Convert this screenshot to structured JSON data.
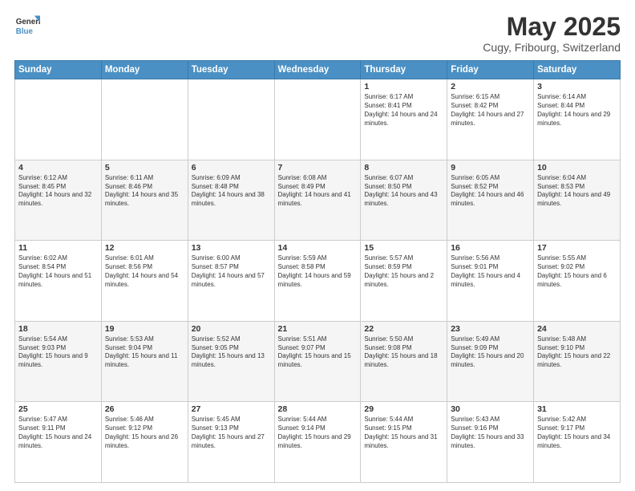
{
  "logo": {
    "line1": "General",
    "line2": "Blue"
  },
  "title": "May 2025",
  "subtitle": "Cugy, Fribourg, Switzerland",
  "days_header": [
    "Sunday",
    "Monday",
    "Tuesday",
    "Wednesday",
    "Thursday",
    "Friday",
    "Saturday"
  ],
  "weeks": [
    [
      {
        "day": "",
        "info": ""
      },
      {
        "day": "",
        "info": ""
      },
      {
        "day": "",
        "info": ""
      },
      {
        "day": "",
        "info": ""
      },
      {
        "day": "1",
        "info": "Sunrise: 6:17 AM\nSunset: 8:41 PM\nDaylight: 14 hours and 24 minutes."
      },
      {
        "day": "2",
        "info": "Sunrise: 6:15 AM\nSunset: 8:42 PM\nDaylight: 14 hours and 27 minutes."
      },
      {
        "day": "3",
        "info": "Sunrise: 6:14 AM\nSunset: 8:44 PM\nDaylight: 14 hours and 29 minutes."
      }
    ],
    [
      {
        "day": "4",
        "info": "Sunrise: 6:12 AM\nSunset: 8:45 PM\nDaylight: 14 hours and 32 minutes."
      },
      {
        "day": "5",
        "info": "Sunrise: 6:11 AM\nSunset: 8:46 PM\nDaylight: 14 hours and 35 minutes."
      },
      {
        "day": "6",
        "info": "Sunrise: 6:09 AM\nSunset: 8:48 PM\nDaylight: 14 hours and 38 minutes."
      },
      {
        "day": "7",
        "info": "Sunrise: 6:08 AM\nSunset: 8:49 PM\nDaylight: 14 hours and 41 minutes."
      },
      {
        "day": "8",
        "info": "Sunrise: 6:07 AM\nSunset: 8:50 PM\nDaylight: 14 hours and 43 minutes."
      },
      {
        "day": "9",
        "info": "Sunrise: 6:05 AM\nSunset: 8:52 PM\nDaylight: 14 hours and 46 minutes."
      },
      {
        "day": "10",
        "info": "Sunrise: 6:04 AM\nSunset: 8:53 PM\nDaylight: 14 hours and 49 minutes."
      }
    ],
    [
      {
        "day": "11",
        "info": "Sunrise: 6:02 AM\nSunset: 8:54 PM\nDaylight: 14 hours and 51 minutes."
      },
      {
        "day": "12",
        "info": "Sunrise: 6:01 AM\nSunset: 8:56 PM\nDaylight: 14 hours and 54 minutes."
      },
      {
        "day": "13",
        "info": "Sunrise: 6:00 AM\nSunset: 8:57 PM\nDaylight: 14 hours and 57 minutes."
      },
      {
        "day": "14",
        "info": "Sunrise: 5:59 AM\nSunset: 8:58 PM\nDaylight: 14 hours and 59 minutes."
      },
      {
        "day": "15",
        "info": "Sunrise: 5:57 AM\nSunset: 8:59 PM\nDaylight: 15 hours and 2 minutes."
      },
      {
        "day": "16",
        "info": "Sunrise: 5:56 AM\nSunset: 9:01 PM\nDaylight: 15 hours and 4 minutes."
      },
      {
        "day": "17",
        "info": "Sunrise: 5:55 AM\nSunset: 9:02 PM\nDaylight: 15 hours and 6 minutes."
      }
    ],
    [
      {
        "day": "18",
        "info": "Sunrise: 5:54 AM\nSunset: 9:03 PM\nDaylight: 15 hours and 9 minutes."
      },
      {
        "day": "19",
        "info": "Sunrise: 5:53 AM\nSunset: 9:04 PM\nDaylight: 15 hours and 11 minutes."
      },
      {
        "day": "20",
        "info": "Sunrise: 5:52 AM\nSunset: 9:05 PM\nDaylight: 15 hours and 13 minutes."
      },
      {
        "day": "21",
        "info": "Sunrise: 5:51 AM\nSunset: 9:07 PM\nDaylight: 15 hours and 15 minutes."
      },
      {
        "day": "22",
        "info": "Sunrise: 5:50 AM\nSunset: 9:08 PM\nDaylight: 15 hours and 18 minutes."
      },
      {
        "day": "23",
        "info": "Sunrise: 5:49 AM\nSunset: 9:09 PM\nDaylight: 15 hours and 20 minutes."
      },
      {
        "day": "24",
        "info": "Sunrise: 5:48 AM\nSunset: 9:10 PM\nDaylight: 15 hours and 22 minutes."
      }
    ],
    [
      {
        "day": "25",
        "info": "Sunrise: 5:47 AM\nSunset: 9:11 PM\nDaylight: 15 hours and 24 minutes."
      },
      {
        "day": "26",
        "info": "Sunrise: 5:46 AM\nSunset: 9:12 PM\nDaylight: 15 hours and 26 minutes."
      },
      {
        "day": "27",
        "info": "Sunrise: 5:45 AM\nSunset: 9:13 PM\nDaylight: 15 hours and 27 minutes."
      },
      {
        "day": "28",
        "info": "Sunrise: 5:44 AM\nSunset: 9:14 PM\nDaylight: 15 hours and 29 minutes."
      },
      {
        "day": "29",
        "info": "Sunrise: 5:44 AM\nSunset: 9:15 PM\nDaylight: 15 hours and 31 minutes."
      },
      {
        "day": "30",
        "info": "Sunrise: 5:43 AM\nSunset: 9:16 PM\nDaylight: 15 hours and 33 minutes."
      },
      {
        "day": "31",
        "info": "Sunrise: 5:42 AM\nSunset: 9:17 PM\nDaylight: 15 hours and 34 minutes."
      }
    ]
  ]
}
